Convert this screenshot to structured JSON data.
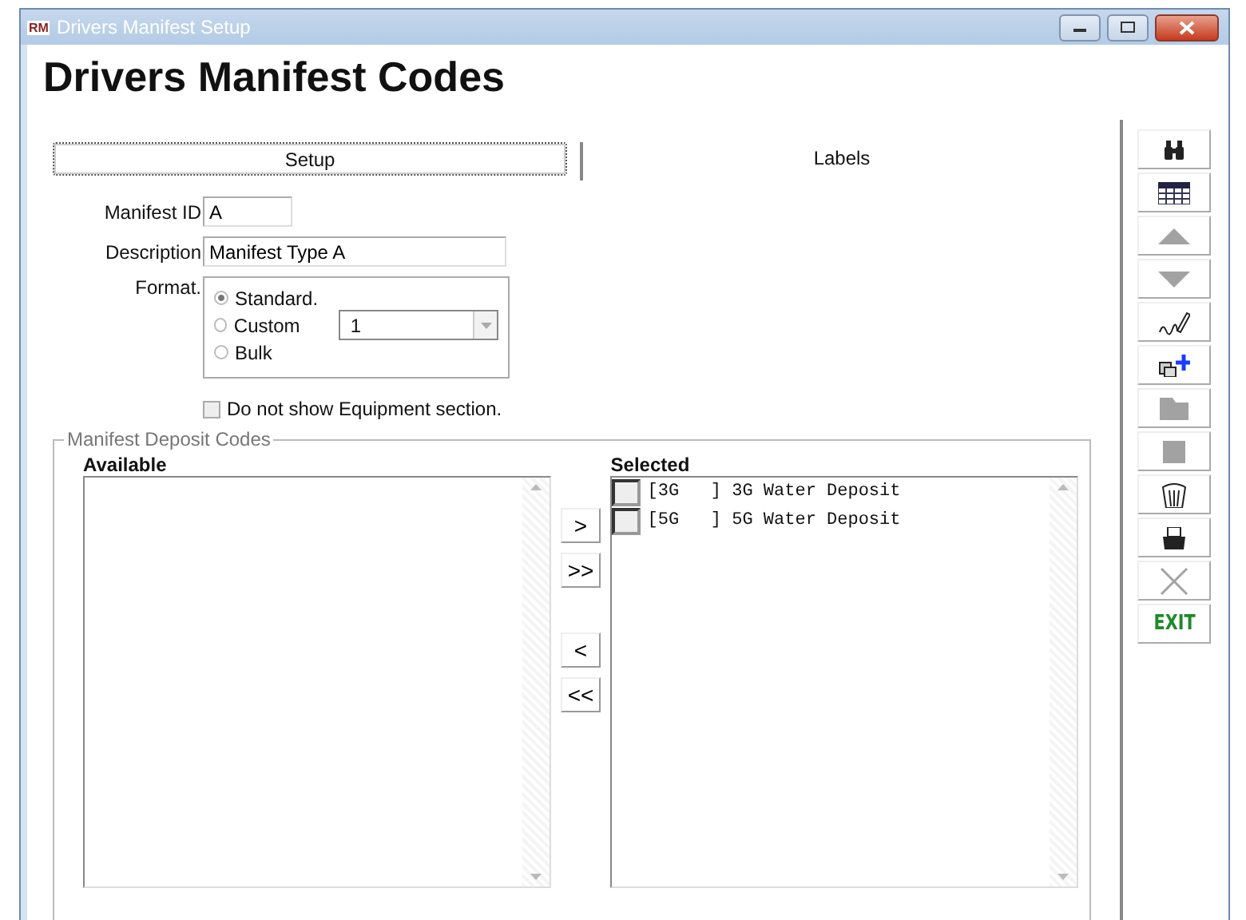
{
  "window": {
    "title": "Drivers Manifest Setup",
    "app_badge": "RM"
  },
  "heading": "Drivers Manifest Codes",
  "tabs": [
    {
      "label": "Setup",
      "selected": true
    },
    {
      "label": "Labels",
      "selected": false
    }
  ],
  "form": {
    "manifest_id": {
      "label": "Manifest ID",
      "value": "A"
    },
    "description": {
      "label": "Description",
      "value": "Manifest Type A"
    },
    "format": {
      "label": "Format.",
      "options": [
        {
          "label": "Standard.",
          "selected": true
        },
        {
          "label": "Custom",
          "selected": false
        },
        {
          "label": "Bulk",
          "selected": false
        }
      ],
      "custom_value": "1"
    },
    "equipment_checkbox": {
      "label": "Do not show Equipment section.",
      "checked": false
    }
  },
  "deposit_codes": {
    "title": "Manifest Deposit Codes",
    "available": {
      "label": "Available"
    },
    "selected": {
      "label": "Selected",
      "rows": [
        {
          "text": "[3G   ] 3G Water Deposit",
          "checked": false
        },
        {
          "text": "[5G   ] 5G Water Deposit",
          "checked": false
        }
      ]
    },
    "move_buttons": [
      ">",
      ">>",
      "<",
      "<<"
    ]
  },
  "toolbar": [
    {
      "kind": "binoculars",
      "disabled": false
    },
    {
      "kind": "grid",
      "disabled": false
    },
    {
      "kind": "up",
      "disabled": true
    },
    {
      "kind": "down",
      "disabled": true
    },
    {
      "kind": "sign",
      "disabled": false
    },
    {
      "kind": "add",
      "disabled": false
    },
    {
      "kind": "folder",
      "disabled": true
    },
    {
      "kind": "square",
      "disabled": true
    },
    {
      "kind": "trash",
      "disabled": false
    },
    {
      "kind": "print",
      "disabled": false
    },
    {
      "kind": "cross",
      "disabled": true
    },
    {
      "kind": "text",
      "label": "EXIT",
      "disabled": false
    }
  ]
}
